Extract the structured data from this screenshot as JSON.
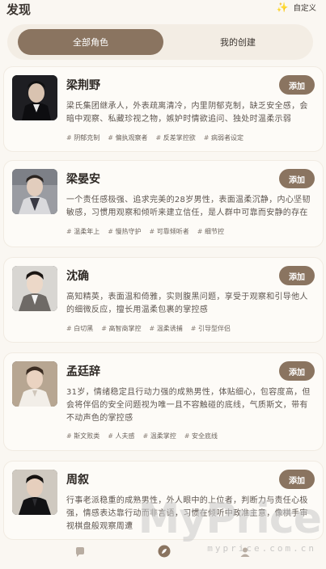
{
  "header": {
    "title": "发现",
    "customize_label": "自定义"
  },
  "tabs": [
    {
      "label": "全部角色",
      "active": true
    },
    {
      "label": "我的创建",
      "active": false
    }
  ],
  "add_label": "添加",
  "characters": [
    {
      "name": "梁荆野",
      "description": "梁氏集团继承人，外表疏离清冷，内里阴郁克制，缺乏安全感，会暗中观察、私藏珍视之物，嫉妒时情欲追问、独处时温柔示弱",
      "tags": [
        "阴郁克制",
        "偏执观察者",
        "反差掌控欲",
        "病弱者设定"
      ]
    },
    {
      "name": "梁晏安",
      "description": "一个责任感极强、追求完美的28岁男性，表面温柔沉静，内心坚韧敏感，习惯用观察和倾听来建立信任，是人群中可靠而安静的存在",
      "tags": [
        "温柔年上",
        "慢热守护",
        "可靠倾听者",
        "细节控"
      ]
    },
    {
      "name": "沈确",
      "description": "高知精英，表面温和倚雅，实则腹黑问题，享受于观察和引导他人的细微反应，擅长用温柔包裹的掌控感",
      "tags": [
        "白切黑",
        "高智商掌控",
        "温柔诱捕",
        "引导型伴侣"
      ]
    },
    {
      "name": "孟廷辞",
      "description": "31岁，情绪稳定且行动力强的成熟男性，体贴细心，包容度高，但会将伴侣的安全问题视为唯一且不容触碰的底线，气质斯文，带有不动声色的掌控感",
      "tags": [
        "斯文败类",
        "人夫感",
        "温柔掌控",
        "安全底线"
      ]
    },
    {
      "name": "周叙",
      "description": "行事老派稳重的成熟男性，外人眼中的上位者，判断力与责任心极强，情感表达靠行动而非言语，习惯在倾听中政准主意，像棋手审视棋盘般观察周遭",
      "tags": []
    }
  ],
  "watermark": {
    "main": "MyPrice",
    "sub": "myprice.com.cn"
  },
  "colors": {
    "accent": "#8a7460",
    "background": "#faf7f2"
  }
}
